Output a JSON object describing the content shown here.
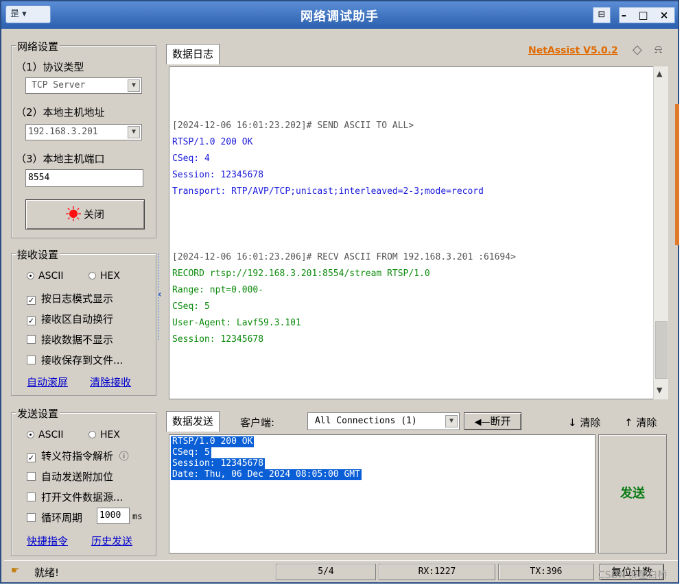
{
  "window": {
    "title": "网络调试助手",
    "sys_icon": "昰 ▾",
    "pin_icon": "⊟",
    "controls": "– □ ×"
  },
  "net_settings": {
    "group": "网络设置",
    "protocol_label": "（1）协议类型",
    "protocol_value": "TCP Server",
    "host_addr_label": "（2）本地主机地址",
    "host_addr_value": "192.168.3.201",
    "host_port_label": "（3）本地主机端口",
    "host_port_value": "8554",
    "close_button": "关闭"
  },
  "recv_settings": {
    "group": "接收设置",
    "ascii": "ASCII",
    "hex": "HEX",
    "options": [
      {
        "label": "按日志模式显示",
        "checked": true
      },
      {
        "label": "接收区自动换行",
        "checked": true
      },
      {
        "label": "接收数据不显示",
        "checked": false
      },
      {
        "label": "接收保存到文件...",
        "checked": false
      }
    ],
    "auto_scroll": "自动滚屏",
    "clear_recv": "清除接收"
  },
  "send_settings": {
    "group": "发送设置",
    "ascii": "ASCII",
    "hex": "HEX",
    "options": [
      {
        "label": "转义符指令解析",
        "checked": true
      },
      {
        "label": "自动发送附加位",
        "checked": false
      },
      {
        "label": "打开文件数据源...",
        "checked": false
      },
      {
        "label": "循环周期",
        "checked": false
      }
    ],
    "info_icon": "ⓘ",
    "cycle_value": "1000",
    "cycle_unit": "ms",
    "shortcut": "快捷指令",
    "history": "历史发送"
  },
  "log": {
    "tab": "数据日志",
    "brand": "NetAssist V5.0.2",
    "lines": [
      {
        "text": "[2024-12-06 16:01:23.202]# SEND ASCII TO ALL>",
        "color": "#555555"
      },
      {
        "text": "RTSP/1.0 200 OK",
        "color": "#1a1adc"
      },
      {
        "text": "CSeq: 4",
        "color": "#1a1adc"
      },
      {
        "text": "Session: 12345678",
        "color": "#1a1adc"
      },
      {
        "text": "Transport: RTP/AVP/TCP;unicast;interleaved=2-3;mode=record",
        "color": "#1a1adc"
      },
      {
        "text": "[2024-12-06 16:01:23.206]# RECV ASCII FROM 192.168.3.201 :61694>",
        "color": "#555555"
      },
      {
        "text": "RECORD rtsp://192.168.3.201:8554/stream RTSP/1.0",
        "color": "#0a8a0a"
      },
      {
        "text": "Range: npt=0.000-",
        "color": "#0a8a0a"
      },
      {
        "text": "CSeq: 5",
        "color": "#0a8a0a"
      },
      {
        "text": "User-Agent: Lavf59.3.101",
        "color": "#0a8a0a"
      },
      {
        "text": "Session: 12345678",
        "color": "#0a8a0a"
      }
    ]
  },
  "send_panel": {
    "tab": "数据发送",
    "client_label": "客户端:",
    "connections": "All Connections (1)",
    "disconnect": "断开",
    "clear1": "清除",
    "clear2": "清除",
    "lines": [
      "RTSP/1.0 200 OK",
      "CSeq: 5",
      "Session: 12345678",
      "Date: Thu, 06 Dec 2024 08:05:00 GMT"
    ],
    "send_button": "发送"
  },
  "status": {
    "ready": "就绪!",
    "count": "5/4",
    "rx": "RX:1227",
    "tx": "TX:396",
    "reset": "复位计数",
    "watermark": "CSDN @墨白桥"
  },
  "colors": {
    "title_bar": "#2c5fae",
    "brand": "#e06a00",
    "send_button": "#0a7a12",
    "selection": "#0a5fd6"
  }
}
